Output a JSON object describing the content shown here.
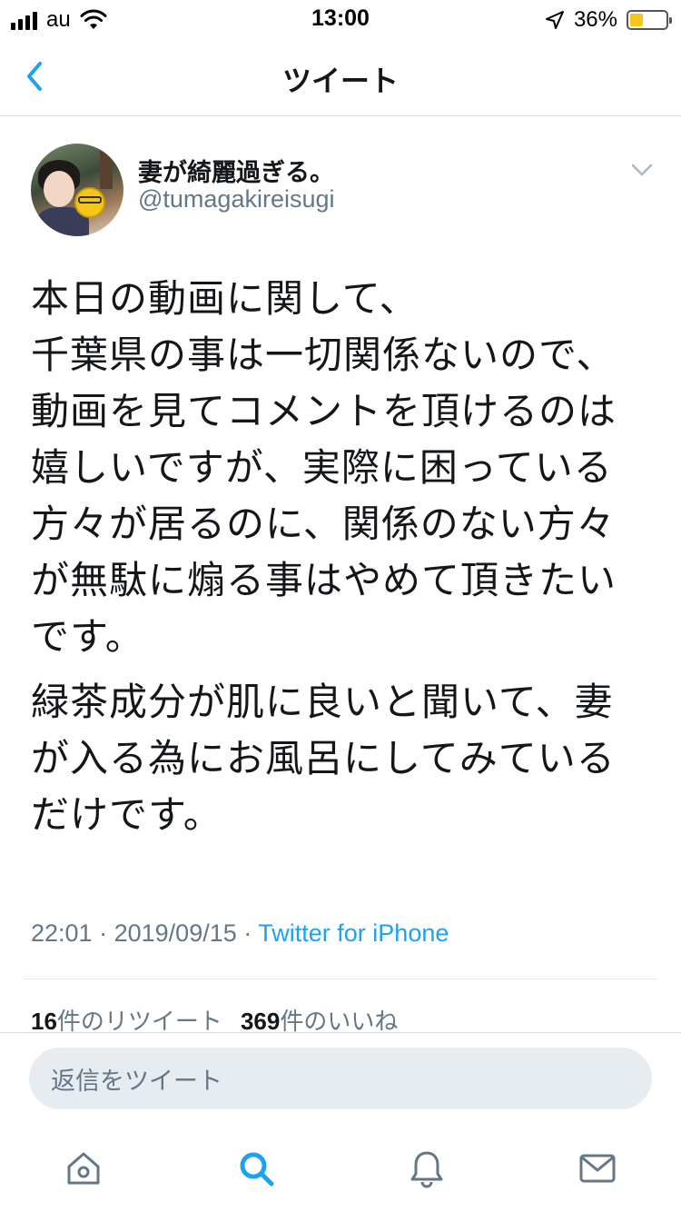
{
  "status_bar": {
    "carrier": "au",
    "time": "13:00",
    "battery_percent": "36%",
    "battery_level": 0.36,
    "icons": [
      "signal-bars-icon",
      "wifi-icon",
      "location-arrow-icon",
      "battery-icon"
    ]
  },
  "nav": {
    "title": "ツイート",
    "back_icon": "chevron-left-icon"
  },
  "tweet": {
    "display_name": "妻が綺麗過ぎる。",
    "handle": "@tumagakireisugi",
    "menu_icon": "chevron-down-icon",
    "paragraphs": [
      "本日の動画に関して、\n千葉県の事は一切関係ないので、\n動画を見てコメントを頂けるのは\n嬉しいですが、実際に困っている\n方々が居るのに、関係のない方々\nが無駄に煽る事はやめて頂きたい\nです。",
      "緑茶成分が肌に良いと聞いて、妻\nが入る為にお風呂にしてみている\nだけです。"
    ],
    "time": "22:01",
    "date": "2019/09/15",
    "separator": "·",
    "source": "Twitter for iPhone",
    "retweet_count": "16",
    "retweet_label": "件のリツイート",
    "like_count": "369",
    "like_label": "件のいいね"
  },
  "reply": {
    "placeholder": "返信をツイート"
  },
  "tab_bar": {
    "items": [
      {
        "name": "home-icon"
      },
      {
        "name": "search-icon",
        "active": true
      },
      {
        "name": "notifications-bell-icon"
      },
      {
        "name": "messages-envelope-icon"
      }
    ]
  },
  "colors": {
    "accent": "#1da1f2",
    "text_primary": "#14171a",
    "text_secondary": "#657786",
    "reply_bg": "#e6ecf0",
    "icon_gray": "#657786"
  }
}
